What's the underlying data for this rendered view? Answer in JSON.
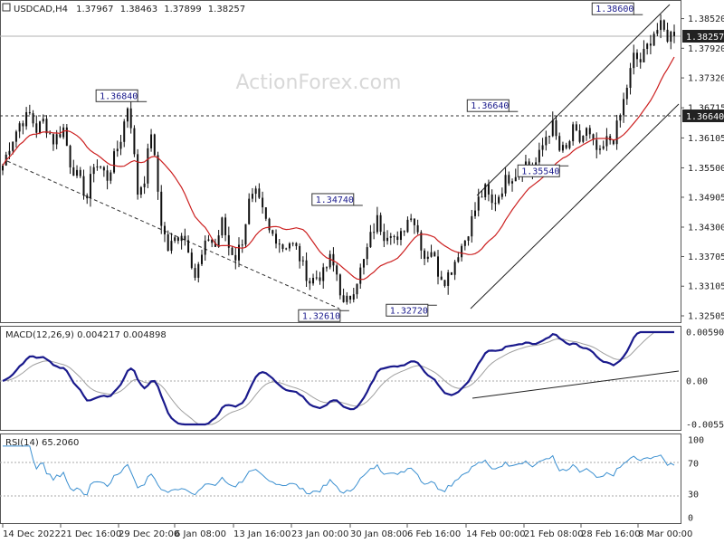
{
  "symbol": "USDCAD",
  "timeframe": "H4",
  "ohlc": {
    "open": "1.37967",
    "high": "1.38463",
    "low": "1.37899",
    "close": "1.38257"
  },
  "watermark": "ActionForex.com",
  "chart_data": [
    {
      "type": "candlestick",
      "title": "USDCAD,H4",
      "ylim": [
        1.3245,
        1.3875
      ],
      "yticks": [
        "1.38520",
        "1.37920",
        "1.37320",
        "1.36715",
        "1.36105",
        "1.35500",
        "1.34905",
        "1.34300",
        "1.33705",
        "1.33105",
        "1.32505"
      ],
      "ytick_values": [
        1.3852,
        1.3792,
        1.3732,
        1.36715,
        1.36105,
        1.355,
        1.34905,
        1.343,
        1.33705,
        1.33105,
        1.32505
      ],
      "current_price": {
        "label": "1.38257",
        "value": 1.38257
      },
      "support_line": {
        "label": "1.36640",
        "value": 1.3664
      },
      "annotations": [
        {
          "label": "1.36840",
          "value": 1.3684,
          "date": "2 Jan 2023"
        },
        {
          "label": "1.32610",
          "value": 1.3261,
          "date": "2 Feb 2023"
        },
        {
          "label": "1.34740",
          "value": 1.3474,
          "date": "3 Feb 2023"
        },
        {
          "label": "1.32720",
          "value": 1.3272,
          "date": "14 Feb 2023"
        },
        {
          "label": "1.36640",
          "value": 1.3664,
          "date": "23 Feb 2023"
        },
        {
          "label": "1.35540",
          "value": 1.3554,
          "date": "28 Feb 2023"
        },
        {
          "label": "1.38600",
          "value": 1.386,
          "date": "8 Mar 2023"
        }
      ],
      "close_path": [
        [
          0,
          1.3555
        ],
        [
          2,
          1.3595
        ],
        [
          5,
          1.364
        ],
        [
          8,
          1.3658
        ],
        [
          10,
          1.3627
        ],
        [
          12,
          1.3645
        ],
        [
          15,
          1.3605
        ],
        [
          18,
          1.363
        ],
        [
          20,
          1.356
        ],
        [
          23,
          1.352
        ],
        [
          25,
          1.349
        ],
        [
          27,
          1.356
        ],
        [
          29,
          1.355
        ],
        [
          31,
          1.353
        ],
        [
          33,
          1.357
        ],
        [
          35,
          1.361
        ],
        [
          37,
          1.3675
        ],
        [
          38,
          1.364
        ],
        [
          40,
          1.35
        ],
        [
          42,
          1.353
        ],
        [
          44,
          1.3625
        ],
        [
          45,
          1.3565
        ],
        [
          47,
          1.344
        ],
        [
          49,
          1.3385
        ],
        [
          51,
          1.3405
        ],
        [
          53,
          1.342
        ],
        [
          55,
          1.339
        ],
        [
          57,
          1.333
        ],
        [
          59,
          1.337
        ],
        [
          61,
          1.341
        ],
        [
          63,
          1.339
        ],
        [
          65,
          1.344
        ],
        [
          67,
          1.339
        ],
        [
          69,
          1.337
        ],
        [
          71,
          1.3405
        ],
        [
          73,
          1.348
        ],
        [
          75,
          1.3495
        ],
        [
          77,
          1.346
        ],
        [
          79,
          1.342
        ],
        [
          81,
          1.341
        ],
        [
          83,
          1.339
        ],
        [
          85,
          1.34
        ],
        [
          87,
          1.3385
        ],
        [
          89,
          1.335
        ],
        [
          91,
          1.332
        ],
        [
          93,
          1.333
        ],
        [
          95,
          1.3335
        ],
        [
          97,
          1.3365
        ],
        [
          99,
          1.3335
        ],
        [
          101,
          1.327
        ],
        [
          103,
          1.329
        ],
        [
          105,
          1.3325
        ],
        [
          107,
          1.336
        ],
        [
          109,
          1.341
        ],
        [
          111,
          1.3445
        ],
        [
          113,
          1.3415
        ],
        [
          115,
          1.3425
        ],
        [
          117,
          1.3395
        ],
        [
          119,
          1.343
        ],
        [
          121,
          1.346
        ],
        [
          123,
          1.342
        ],
        [
          125,
          1.337
        ],
        [
          127,
          1.3385
        ],
        [
          129,
          1.334
        ],
        [
          131,
          1.3325
        ],
        [
          133,
          1.3345
        ],
        [
          135,
          1.338
        ],
        [
          137,
          1.3405
        ],
        [
          139,
          1.3445
        ],
        [
          141,
          1.3485
        ],
        [
          143,
          1.3505
        ],
        [
          145,
          1.3475
        ],
        [
          147,
          1.3495
        ],
        [
          149,
          1.3525
        ],
        [
          151,
          1.3535
        ],
        [
          153,
          1.3545
        ],
        [
          155,
          1.356
        ],
        [
          157,
          1.3545
        ],
        [
          159,
          1.3575
        ],
        [
          161,
          1.3615
        ],
        [
          163,
          1.3635
        ],
        [
          165,
          1.3585
        ],
        [
          167,
          1.3585
        ],
        [
          169,
          1.3625
        ],
        [
          171,
          1.3605
        ],
        [
          173,
          1.3625
        ],
        [
          175,
          1.3595
        ],
        [
          177,
          1.3575
        ],
        [
          179,
          1.3605
        ],
        [
          181,
          1.361
        ],
        [
          183,
          1.3655
        ],
        [
          185,
          1.3715
        ],
        [
          187,
          1.3775
        ],
        [
          189,
          1.3765
        ],
        [
          191,
          1.3795
        ],
        [
          193,
          1.3825
        ],
        [
          195,
          1.3835
        ],
        [
          197,
          1.3815
        ],
        [
          199,
          1.3826
        ]
      ]
    },
    {
      "type": "line",
      "title": "MACD(12,26,9) 0.004217 0.004898",
      "yticks": [
        "0.005908",
        "0.00",
        "-0.005563"
      ],
      "ytick_values": [
        0.005908,
        0.0,
        -0.005563
      ]
    },
    {
      "type": "line",
      "title": "RSI(14) 65.2060",
      "ylim": [
        0,
        100
      ],
      "yticks": [
        "100",
        "70",
        "30",
        "0"
      ],
      "ytick_values": [
        100,
        70,
        30,
        0
      ]
    }
  ],
  "x_axis": {
    "labels": [
      "14 Dec 2022",
      "21 Dec 16:00",
      "29 Dec 20:00",
      "6 Jan 08:00",
      "13 Jan 16:00",
      "23 Jan 00:00",
      "30 Jan 08:00",
      "6 Feb 16:00",
      "14 Feb 00:00",
      "21 Feb 08:00",
      "28 Feb 16:00",
      "8 Mar 00:00"
    ]
  },
  "colors": {
    "candle": "#101010",
    "ma": "#cc2020",
    "macd": "#1a1a8c",
    "signal": "#a0a0a0",
    "rsi": "#3a8fd0",
    "channel": "#222222"
  }
}
